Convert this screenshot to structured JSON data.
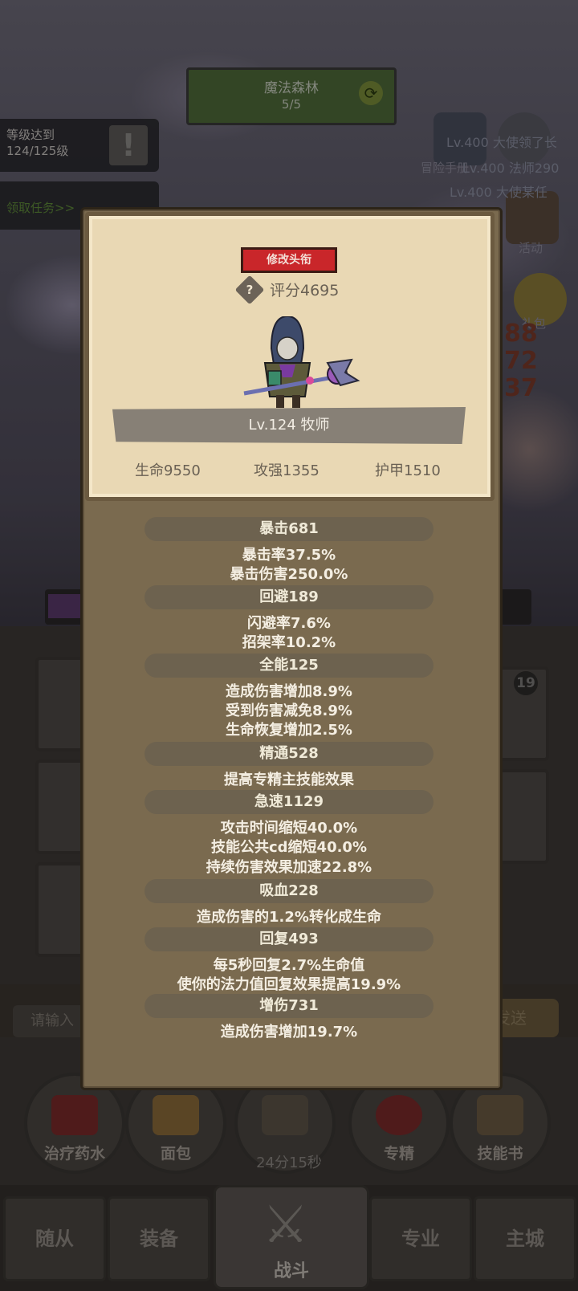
{
  "map": {
    "name": "魔法森林",
    "progress": "5/5"
  },
  "quests": {
    "level_goal": "等级达到124/125级",
    "claim": "领取任务>>"
  },
  "right_icons": {
    "adventure": "冒险手册",
    "activity": "活动",
    "giftbag": "礼包"
  },
  "ghost_messages": [
    "Lv.400 大使领了长",
    "Lv.400 法师290",
    "Lv.400 大使某任"
  ],
  "damage_numbers": [
    "88",
    "72",
    "37"
  ],
  "badge_count": "19",
  "chat": {
    "placeholder": "请输入",
    "send": "发送"
  },
  "actions": [
    {
      "label": "治疗药水",
      "color": "#7a2a2a"
    },
    {
      "label": "面包",
      "color": "#8a6a3a"
    },
    {
      "label": "",
      "color": "#5c5448"
    },
    {
      "label": "专精",
      "color": "#7a2a2a"
    },
    {
      "label": "技能书",
      "color": "#6a5a42"
    }
  ],
  "timer": "24分15秒",
  "nav": {
    "companion": "随从",
    "equipment": "装备",
    "battle": "战斗",
    "profession": "专业",
    "city": "主城"
  },
  "character": {
    "rename_button": "修改头衔",
    "score": "评分4695",
    "level_class": "Lv.124 牧师",
    "hp": "生命9550",
    "attack": "攻强1355",
    "armor": "护甲1510"
  },
  "stats": [
    {
      "head": "暴击681",
      "lines": [
        "暴击率37.5%",
        "暴击伤害250.0%"
      ]
    },
    {
      "head": "回避189",
      "lines": [
        "闪避率7.6%",
        "招架率10.2%"
      ]
    },
    {
      "head": "全能125",
      "lines": [
        "造成伤害增加8.9%",
        "受到伤害减免8.9%",
        "生命恢复增加2.5%"
      ]
    },
    {
      "head": "精通528",
      "lines": [
        "提高专精主技能效果"
      ]
    },
    {
      "head": "急速1129",
      "lines": [
        "攻击时间缩短40.0%",
        "技能公共cd缩短40.0%",
        "持续伤害效果加速22.8%"
      ]
    },
    {
      "head": "吸血228",
      "lines": [
        "造成伤害的1.2%转化成生命"
      ]
    },
    {
      "head": "回复493",
      "lines": [
        "每5秒回复2.7%生命值",
        "使你的法力值回复效果提高19.9%"
      ]
    },
    {
      "head": "增伤731",
      "lines": [
        "造成伤害增加19.7%"
      ]
    }
  ]
}
